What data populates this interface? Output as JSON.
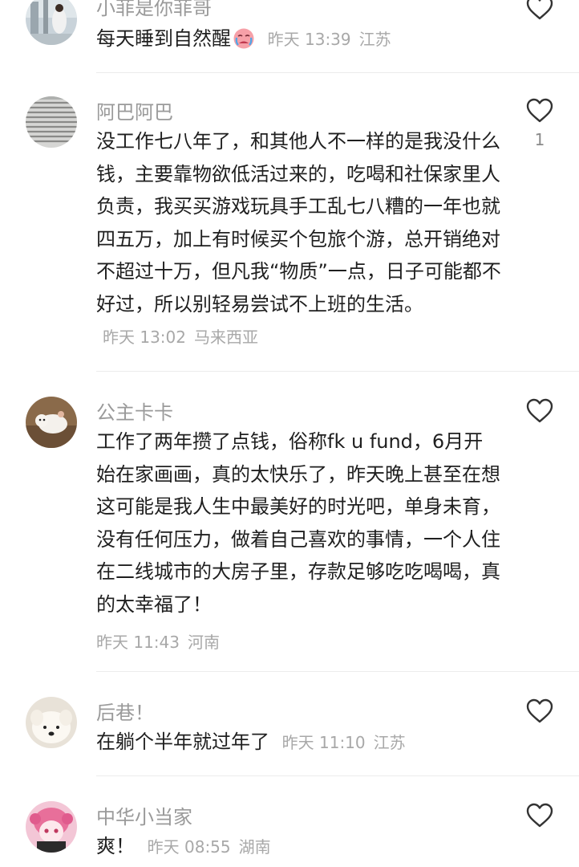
{
  "comments": [
    {
      "username": "小菲是你菲哥",
      "text": "每天睡到自然醒",
      "time": "昨天 13:39",
      "location": "江苏",
      "emoji": "crying-face"
    },
    {
      "username": "阿巴阿巴",
      "text": "没工作七八年了，和其他人不一样的是我没什么钱，主要靠物欲低活过来的，吃喝和社保家里人负责，我买买游戏玩具手工乱七八糟的一年也就四五万，加上有时候买个包旅个游，总开销绝对不超过十万，但凡我“物质”一点，日子可能都不好过，所以别轻易尝试不上班的生活。",
      "time": "昨天 13:02",
      "location": "马来西亚",
      "likes": "1"
    },
    {
      "username": "公主卡卡",
      "text": "工作了两年攒了点钱，俗称fk u fund，6月开始在家画画，真的太快乐了，昨天晚上甚至在想这可能是我人生中最美好的时光吧，单身未育，没有任何压力，做着自己喜欢的事情，一个人住在二线城市的大房子里，存款足够吃吃喝喝，真的太幸福了！",
      "time": "昨天 11:43",
      "location": "河南"
    },
    {
      "username": "后巷！",
      "text": "在躺个半年就过年了",
      "time": "昨天 11:10",
      "location": "江苏"
    },
    {
      "username": "中华小当家",
      "text": "爽！",
      "time": "昨天 08:55",
      "location": "湖南"
    }
  ],
  "colors": {
    "username": "#9a9a9a",
    "text": "#1f1f1f",
    "meta": "#a8a8a8",
    "divider": "#ececec"
  },
  "icons": {
    "like": "heart-outline-icon"
  }
}
